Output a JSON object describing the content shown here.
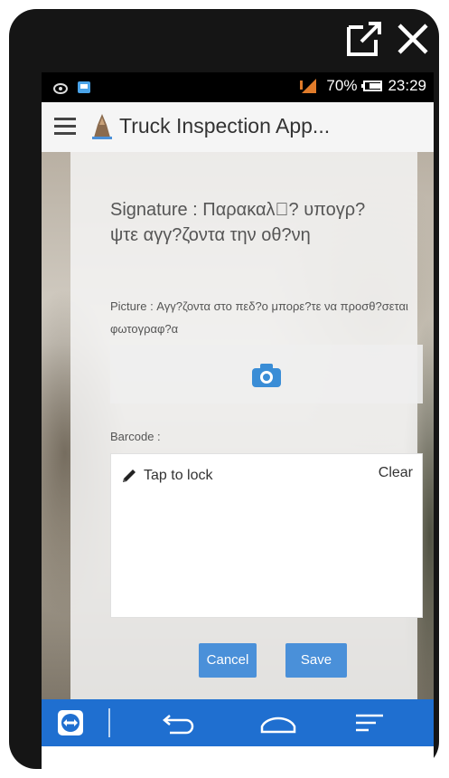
{
  "window": {
    "open_external_icon": "open-in-new-icon",
    "close_icon": "close-icon"
  },
  "status_bar": {
    "icons": [
      "eye-icon",
      "notification-icon",
      "signal-icon",
      "battery-icon"
    ],
    "battery": "70%",
    "time": "23:29"
  },
  "app_bar": {
    "title": "Truck Inspection App..."
  },
  "form": {
    "signature_label": "Signature : Παρακαλ\u0000? υπογρ?ψτε αγγ?ζοντα    την οθ?νη",
    "picture_label": "Picture : Αγγ?ζοντα    στο πεδ?ο μπορε?τε να προσθ?σεται φωτογραφ?α",
    "barcode_label": "Barcode :",
    "tap_to_lock": "Tap to lock",
    "clear": "Clear",
    "cancel": "Cancel",
    "save": "Save"
  },
  "nav_bar": {
    "items": [
      "teamviewer-icon",
      "back-icon",
      "home-icon",
      "recents-icon"
    ]
  },
  "colors": {
    "accent": "#4a90d9",
    "nav_bar": "#1f6fd0",
    "status_bar": "#000000"
  }
}
